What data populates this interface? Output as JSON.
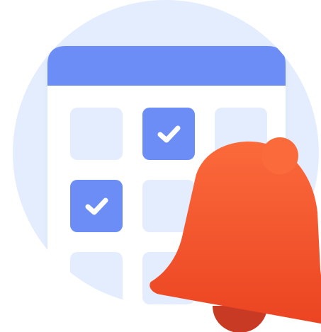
{
  "illustration": {
    "background_circle_color": "#e3edfd",
    "calendar": {
      "header_color": "#6c8cf6",
      "body_color": "#ffffff",
      "cell_color": "#e3edfd",
      "checked_cell_color": "#6c8cf6",
      "check_color": "#ffffff",
      "grid": [
        [
          false,
          true,
          false
        ],
        [
          true,
          false,
          false
        ],
        [
          false,
          false,
          false
        ]
      ]
    },
    "bell": {
      "icon": "bell-icon",
      "gradient_top": "#fb6a3b",
      "gradient_bottom": "#eb4422",
      "clapper_color": "#c83a23"
    }
  }
}
